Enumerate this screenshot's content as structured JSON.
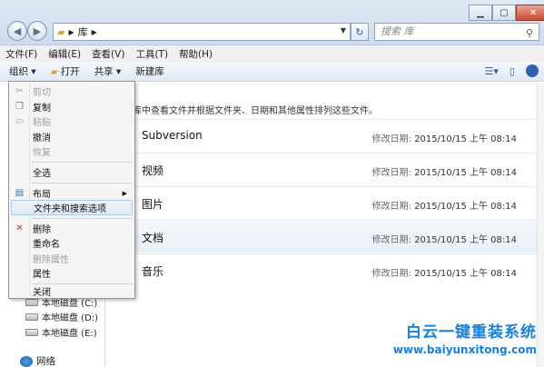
{
  "address": {
    "crumb": "库",
    "search_placeholder": "搜索 库"
  },
  "menubar": [
    "文件(F)",
    "编辑(E)",
    "查看(V)",
    "工具(T)",
    "帮助(H)"
  ],
  "toolbar": {
    "organize": "组织 ▾",
    "open": "打开",
    "share": "共享 ▾",
    "new_library": "新建库"
  },
  "description": "库中查看文件并根据文件夹、日期和其他属性排列这些文件。",
  "libraries": [
    {
      "name": "Subversion",
      "date_label": "修改日期:",
      "date": "2015/10/15 上午 08:14"
    },
    {
      "name": "视频",
      "date_label": "修改日期:",
      "date": "2015/10/15 上午 08:14"
    },
    {
      "name": "图片",
      "date_label": "修改日期:",
      "date": "2015/10/15 上午 08:14"
    },
    {
      "name": "文档",
      "date_label": "修改日期:",
      "date": "2015/10/15 上午 08:14"
    },
    {
      "name": "音乐",
      "date_label": "修改日期:",
      "date": "2015/10/15 上午 08:14"
    }
  ],
  "nav": {
    "drive_c": "本地磁盘 (C:)",
    "drive_d": "本地磁盘 (D:)",
    "drive_e": "本地磁盘 (E:)",
    "network": "网络"
  },
  "menu": {
    "cut": "剪切",
    "copy": "复制",
    "paste": "粘贴",
    "undo": "撤消",
    "redo": "恢复",
    "select_all": "全选",
    "layout": "布局",
    "folder_options": "文件夹和搜索选项",
    "delete": "删除",
    "rename": "重命名",
    "remove_props": "删除属性",
    "properties": "属性",
    "close": "关闭"
  },
  "watermark": {
    "title": "白云一键重装系统",
    "url": "www.baiyunxitong.com"
  }
}
